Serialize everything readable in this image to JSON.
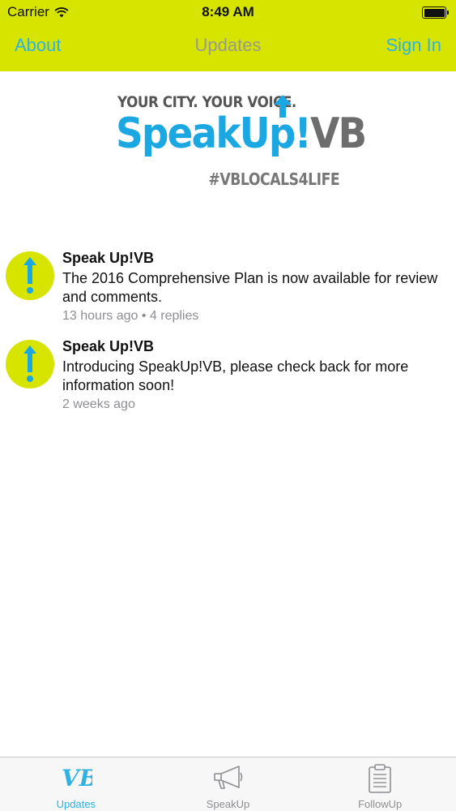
{
  "status_bar": {
    "carrier": "Carrier",
    "time": "8:49 AM",
    "battery_level": 1.0
  },
  "nav": {
    "left_label": "About",
    "title": "Updates",
    "right_label": "Sign In"
  },
  "logo": {
    "tagline": "YOUR CITY. YOUR VOICE.",
    "brand_part1": "SpeakUp",
    "brand_part2": "!",
    "brand_part3": "VB",
    "hashtag": "#VBLOCALS4LIFE"
  },
  "posts": [
    {
      "author": "Speak Up!VB",
      "body": "The 2016 Comprehensive Plan is now available for review and comments.",
      "meta": "13 hours ago • 4 replies"
    },
    {
      "author": "Speak Up!VB",
      "body": "Introducing SpeakUp!VB, please check back for more information soon!",
      "meta": "2 weeks ago"
    }
  ],
  "tabs": [
    {
      "label": "Updates",
      "icon": "vb-logo-icon",
      "active": true
    },
    {
      "label": "SpeakUp",
      "icon": "megaphone-icon",
      "active": false
    },
    {
      "label": "FollowUp",
      "icon": "clipboard-icon",
      "active": false
    }
  ],
  "colors": {
    "header_bg": "#d6e400",
    "accent_blue": "#2db2e2",
    "title_gray": "#9a9a8a",
    "avatar_bg": "#d6e400"
  }
}
